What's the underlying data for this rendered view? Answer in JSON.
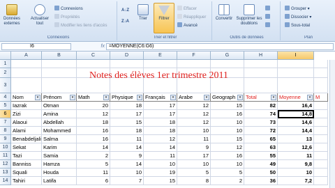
{
  "ribbon": {
    "groups": [
      {
        "label": "Connexions"
      },
      {
        "label": "Trier et filtrer"
      },
      {
        "label": "Outils de données"
      },
      {
        "label": "Plan"
      }
    ],
    "donnees_externes": "Données externes",
    "actualiser": "Actualiser tout",
    "connexions": "Connexions",
    "proprietes": "Propriétés",
    "modifier_liens": "Modifier les liens d'accès",
    "trier": "Trier",
    "filtrer": "Filtrer",
    "effacer": "Effacer",
    "reappliquer": "Réappliquer",
    "avance": "Avancé",
    "convertir": "Convertir",
    "supprimer_doublons": "Supprimer les doublons",
    "grouper": "Grouper",
    "dissocier": "Dissocier",
    "sous_total": "Sous-total"
  },
  "formula_bar": {
    "name_box": "I6",
    "fx": "fx",
    "formula": "=MOYENNE(C6:G6)"
  },
  "columns": [
    "A",
    "B",
    "C",
    "D",
    "E",
    "F",
    "G",
    "H",
    "I"
  ],
  "rows": [
    "1",
    "2",
    "3",
    "4",
    "5",
    "6",
    "7",
    "8",
    "9",
    "10",
    "11",
    "12",
    "13",
    "14"
  ],
  "title": "Notes des élèves 1er trimestre 2011",
  "headers": [
    "Nom",
    "Prénom",
    "Math",
    "Physique",
    "Français",
    "Arabe",
    "Geograph",
    "Total",
    "Moyenne",
    "M"
  ],
  "data": [
    [
      "Iazrak",
      "Otman",
      "20",
      "18",
      "17",
      "12",
      "15",
      "82",
      "16,4"
    ],
    [
      "Zizi",
      "Amina",
      "12",
      "17",
      "17",
      "12",
      "16",
      "74",
      "14,8"
    ],
    [
      "Alaoui",
      "Abdellah",
      "18",
      "15",
      "18",
      "12",
      "10",
      "73",
      "14,6"
    ],
    [
      "Alami",
      "Mohammed",
      "16",
      "18",
      "18",
      "10",
      "10",
      "72",
      "14,4"
    ],
    [
      "Benabdeljalil",
      "Salma",
      "16",
      "11",
      "12",
      "11",
      "15",
      "65",
      "13"
    ],
    [
      "Sekat",
      "Karim",
      "14",
      "14",
      "14",
      "9",
      "12",
      "63",
      "12,6"
    ],
    [
      "Tazi",
      "Samia",
      "2",
      "9",
      "11",
      "17",
      "16",
      "55",
      "11"
    ],
    [
      "Banniss",
      "Hamza",
      "5",
      "14",
      "10",
      "10",
      "10",
      "49",
      "9,8"
    ],
    [
      "Squali",
      "Houda",
      "11",
      "10",
      "19",
      "5",
      "5",
      "50",
      "10"
    ],
    [
      "Tahiri",
      "Latifa",
      "6",
      "7",
      "15",
      "8",
      "2",
      "36",
      "7,2"
    ]
  ]
}
